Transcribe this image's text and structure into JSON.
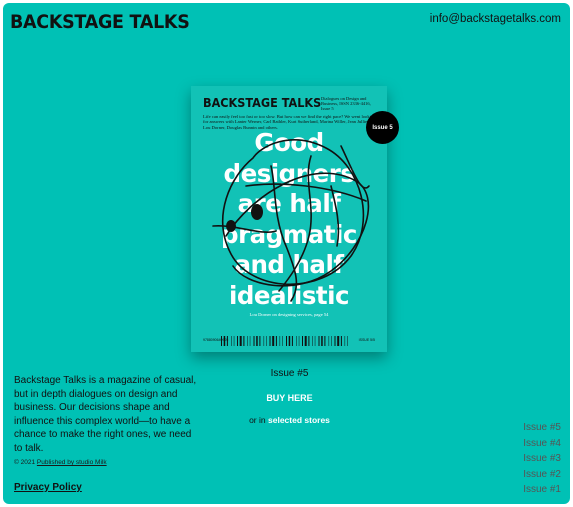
{
  "header": {
    "logo": "BACKSTAGE TALKS",
    "email": "info@backstagetalks.com"
  },
  "cover": {
    "title": "BACKSTAGE TALKS",
    "subtitle": "Dialogues on Design and Business, ISSN 2336-4416, Issue 5",
    "intro": "Life can easily feel too fast or too slow. But how can we find the right pace? We went looking for answers with Lanter Werner, Carl Bathler, Kurt Sutherland, Marina Willer, Jean Jullien, Lou Dorner, Douglas Bunnin and others.",
    "badge": "Issue 5",
    "headline": [
      "Good",
      "designers",
      "are half",
      "pragmatic",
      "and half",
      "idealistic"
    ],
    "caption": "Lou Dorner on designing services, page 54",
    "barcode_left": "9788090649905",
    "barcode_right": "ISSUE 5/5"
  },
  "main": {
    "issue_label": "Issue #5",
    "buy_label": "BUY HERE",
    "or_in": "or in",
    "stores_label": "selected stores"
  },
  "footer": {
    "about": "Backstage Talks is a magazine of casual, but in depth dialogues on design and business. Our decisions shape and influence this complex world—to have a chance to make the right ones, we need to talk.",
    "copyright_prefix": "© 2021",
    "copyright_link": "Published by studio Milk",
    "privacy": "Privacy Policy"
  },
  "issues_nav": [
    "Issue #5",
    "Issue #4",
    "Issue #3",
    "Issue #2",
    "Issue #1"
  ],
  "colors": {
    "background": "#00c1b5",
    "cover": "#12c2b6",
    "text": "#111111",
    "accent": "#ffffff"
  }
}
